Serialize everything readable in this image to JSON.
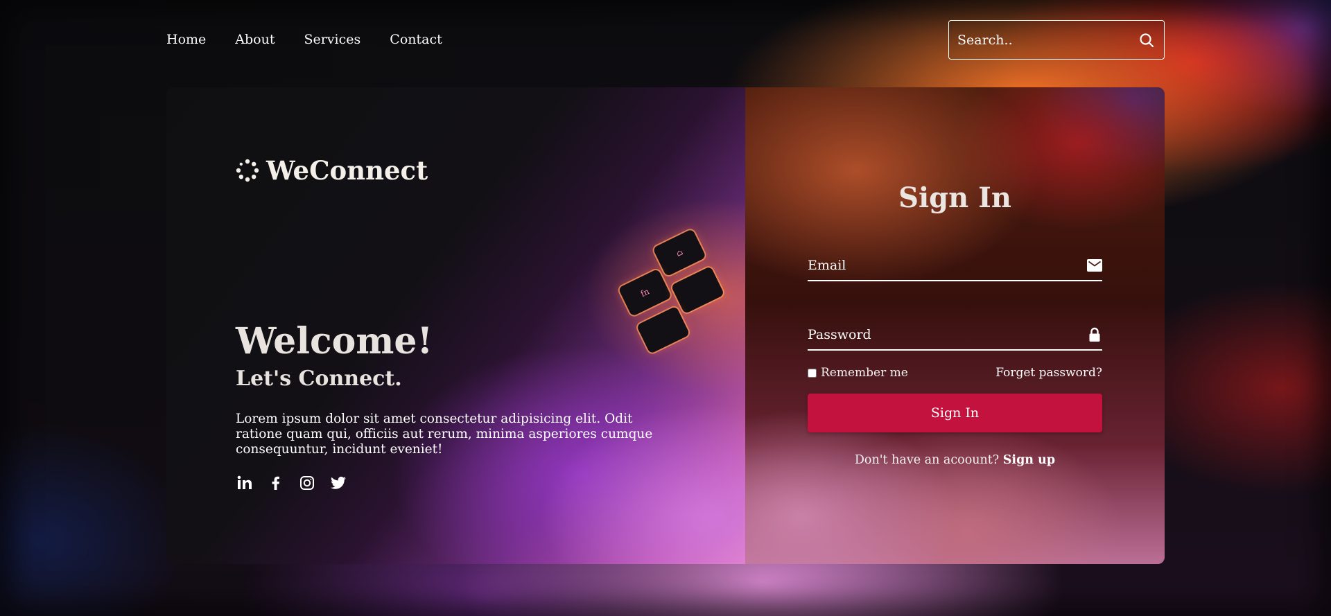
{
  "nav": {
    "items": [
      {
        "label": "Home"
      },
      {
        "label": "About"
      },
      {
        "label": "Services"
      },
      {
        "label": "Contact"
      }
    ]
  },
  "search": {
    "placeholder": "Search..",
    "icon": "search-icon"
  },
  "brand": {
    "name": "WeConnect",
    "icon": "dotted-circle-logo-icon"
  },
  "hero": {
    "title": "Welcome!",
    "subtitle": "Let's Connect.",
    "description": "Lorem ipsum dolor sit amet consectetur adipisicing elit. Odit ratione quam qui, officiis aut rerum, minima asperiores cumque consequuntur, incidunt eveniet!"
  },
  "socials": [
    {
      "icon": "linkedin-icon"
    },
    {
      "icon": "facebook-icon"
    },
    {
      "icon": "instagram-icon"
    },
    {
      "icon": "twitter-icon"
    }
  ],
  "login": {
    "title": "Sign In",
    "email_placeholder": "Email",
    "email_icon": "mail-icon",
    "password_placeholder": "Password",
    "password_icon": "lock-icon",
    "remember_label": "Remember me",
    "remember_checked": false,
    "forgot_label": "Forget password?",
    "submit_label": "Sign In",
    "signup_prompt": "Don't have an acoount?",
    "signup_link": "Sign up"
  },
  "colors": {
    "accent": "#c4123f",
    "text": "#ffffff"
  }
}
